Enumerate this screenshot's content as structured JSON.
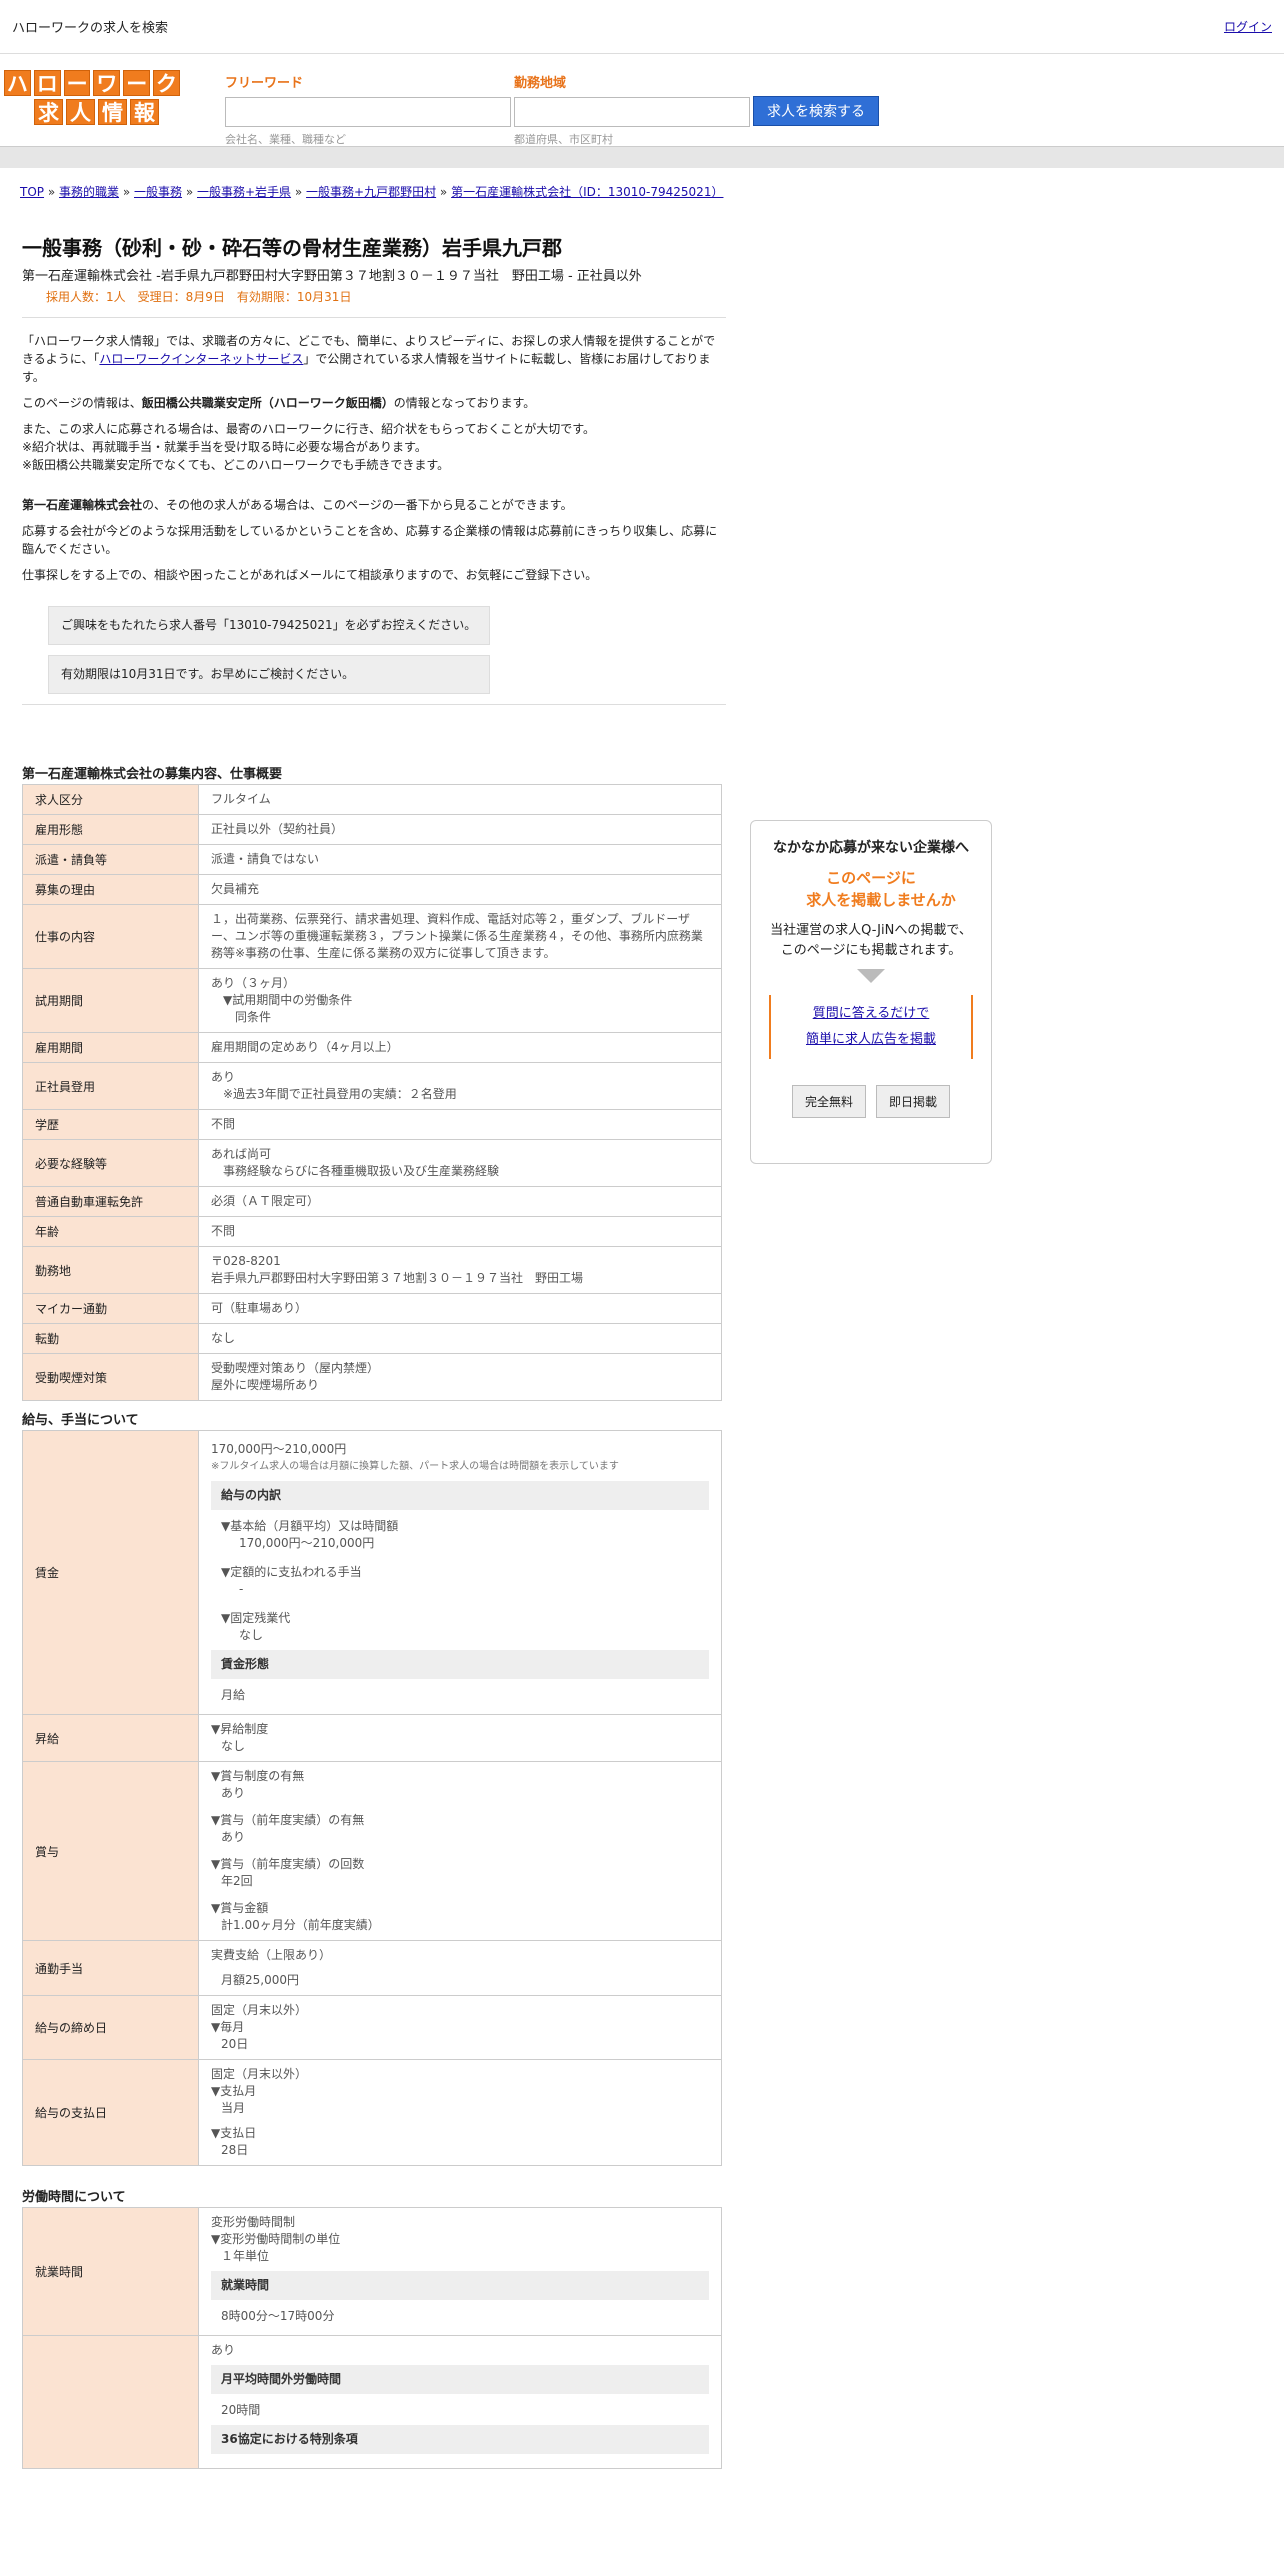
{
  "topbar": {
    "title": "ハローワークの求人を検索",
    "login": "ログイン"
  },
  "logo": {
    "row1": [
      "ハ",
      "ロ",
      "ー",
      "ワ",
      "ー",
      "ク"
    ],
    "row2": [
      "求",
      "人",
      "情",
      "報"
    ]
  },
  "search": {
    "freeword_label": "フリーワード",
    "freeword_hint": "会社名、業種、職種など",
    "area_label": "勤務地域",
    "area_hint": "都道府県、市区町村",
    "button": "求人を検索する"
  },
  "breadcrumb": {
    "items": [
      "TOP",
      "事務的職業",
      "一般事務",
      "一般事務+岩手県",
      "一般事務+九戸郡野田村",
      "第一石産運輸株式会社（ID：13010-79425021）"
    ],
    "sep": " » "
  },
  "job": {
    "title": "一般事務（砂利・砂・砕石等の骨材生産業務）岩手県九戸郡",
    "subtitle": "第一石産運輸株式会社 -岩手県九戸郡野田村大字野田第３７地割３０－１９７当社　野田工場 - 正社員以外",
    "meta": "採用人数：1人　受理日：8月9日　有効期限：10月31日"
  },
  "intro": {
    "p1a": "「ハローワーク求人情報」では、求職者の方々に、どこでも、簡単に、よりスピーディに、お探しの求人情報を提供することができるように、「",
    "p1link": "ハローワークインターネットサービス",
    "p1b": "」で公開されている求人情報を当サイトに転載し、皆様にお届けしております。",
    "p2a": "このページの情報は、",
    "p2b": "飯田橋公共職業安定所（ハローワーク飯田橋）",
    "p2c": "の情報となっております。",
    "p3": "また、この求人に応募される場合は、最寄のハローワークに行き、紹介状をもらっておくことが大切です。",
    "p3b": "※紹介状は、再就職手当・就業手当を受け取る時に必要な場合があります。",
    "p3c": "※飯田橋公共職業安定所でなくても、どこのハローワークでも手続きできます。",
    "p4a": "第一石産運輸株式会社",
    "p4b": "の、その他の求人がある場合は、このページの一番下から見ることができます。",
    "p5": "応募する会社が今どのような採用活動をしているかということを含め、応募する企業様の情報は応募前にきっちり収集し、応募に臨んでください。",
    "p6": "仕事探しをする上での、相談や困ったことがあればメールにて相談承りますので、お気軽にご登録下さい。",
    "notice1": "ご興味をもたれたら求人番号「13010-79425021」を必ずお控えください。",
    "notice2": "有効期限は10月31日です。お早めにご検討ください。"
  },
  "sections": {
    "s1": "第一石産運輸株式会社の募集内容、仕事概要",
    "s2": "給与、手当について",
    "s3": "労働時間について"
  },
  "overview": [
    {
      "k": "求人区分",
      "v": [
        "フルタイム"
      ]
    },
    {
      "k": "雇用形態",
      "v": [
        "正社員以外（契約社員）"
      ]
    },
    {
      "k": "派遣・請負等",
      "v": [
        "派遣・請負ではない"
      ]
    },
    {
      "k": "募集の理由",
      "v": [
        "欠員補充"
      ]
    },
    {
      "k": "仕事の内容",
      "v": [
        "１，出荷業務、伝票発行、請求書処理、資料作成、電話対応等２，重ダンプ、ブルドーザー、ユンボ等の重機運転業務３，プラント操業に係る生産業務４，その他、事務所内庶務業務等※事務の仕事、生産に係る業務の双方に従事して頂きます。"
      ]
    },
    {
      "k": "試用期間",
      "v": [
        "あり（３ヶ月）",
        "　▼試用期間中の労働条件",
        "　　同条件"
      ]
    },
    {
      "k": "雇用期間",
      "v": [
        "雇用期間の定めあり（4ヶ月以上）"
      ]
    },
    {
      "k": "正社員登用",
      "v": [
        "あり",
        "　※過去3年間で正社員登用の実績：２名登用"
      ]
    },
    {
      "k": "学歴",
      "v": [
        "不問"
      ]
    },
    {
      "k": "必要な経験等",
      "v": [
        "あれば尚可",
        "　事務経験ならびに各種重機取扱い及び生産業務経験"
      ]
    },
    {
      "k": "普通自動車運転免許",
      "v": [
        "必須（ＡＴ限定可）"
      ]
    },
    {
      "k": "年齢",
      "v": [
        "不問"
      ]
    },
    {
      "k": "勤務地",
      "v": [
        "〒028-8201",
        "岩手県九戸郡野田村大字野田第３７地割３０－１９７当社　野田工場"
      ]
    },
    {
      "k": "マイカー通勤",
      "v": [
        "可（駐車場あり）"
      ]
    },
    {
      "k": "転勤",
      "v": [
        "なし"
      ]
    },
    {
      "k": "受動喫煙対策",
      "v": [
        "受動喫煙対策あり（屋内禁煙）",
        "屋外に喫煙場所あり"
      ]
    }
  ],
  "salary": {
    "range": "170,000円〜210,000円",
    "note": "※フルタイム求人の場合は月額に換算した額、パート求人の場合は時間額を表示しています",
    "breakdown_title": "給与の内訳",
    "base_label": "▼基本給（月額平均）又は時間額",
    "base_value": "170,000円〜210,000円",
    "fixed_label": "▼定額的に支払われる手当",
    "fixed_value": "-",
    "ot_label": "▼固定残業代",
    "ot_value": "なし",
    "form_title": "賃金形態",
    "form_value": "月給"
  },
  "salary_rows": {
    "wage": "賃金",
    "raise": "昇給",
    "raise_l": "▼昇給制度",
    "raise_v": "なし",
    "bonus": "賞与",
    "b1l": "▼賞与制度の有無",
    "b1v": "あり",
    "b2l": "▼賞与（前年度実績）の有無",
    "b2v": "あり",
    "b3l": "▼賞与（前年度実績）の回数",
    "b3v": "年2回",
    "b4l": "▼賞与金額",
    "b4v": "計1.00ヶ月分（前年度実績）",
    "commute": "通勤手当",
    "c1": "実費支給（上限あり）",
    "c2": "月額25,000円",
    "close": "給与の締め日",
    "cl1": "固定（月末以外）",
    "cl2": "▼毎月",
    "cl3": "20日",
    "pay": "給与の支払日",
    "p1": "固定（月末以外）",
    "p2": "▼支払月",
    "p3": "当月",
    "p4": "▼支払日",
    "p5": "28日"
  },
  "hours": {
    "k1": "就業時間",
    "v1": "変形労働時間制",
    "v2": "▼変形労働時間制の単位",
    "v3": "１年単位",
    "t1": "就業時間",
    "t1v": "8時00分〜17時00分",
    "v4": "あり",
    "t2": "月平均時間外労働時間",
    "t2v": "20時間",
    "t3": "36協定における特別条項"
  },
  "side": {
    "title": "なかなか応募が来ない企業様へ",
    "orange1": "このページに",
    "orange2": "求人を掲載しませんか",
    "p1": "当社運営の求人Q-JiNへの掲載で、",
    "p2": "このページにも掲載されます。",
    "link1": "質問に答えるだけで",
    "link2": "簡単に求人広告を掲載",
    "btn1": "完全無料",
    "btn2": "即日掲載"
  }
}
